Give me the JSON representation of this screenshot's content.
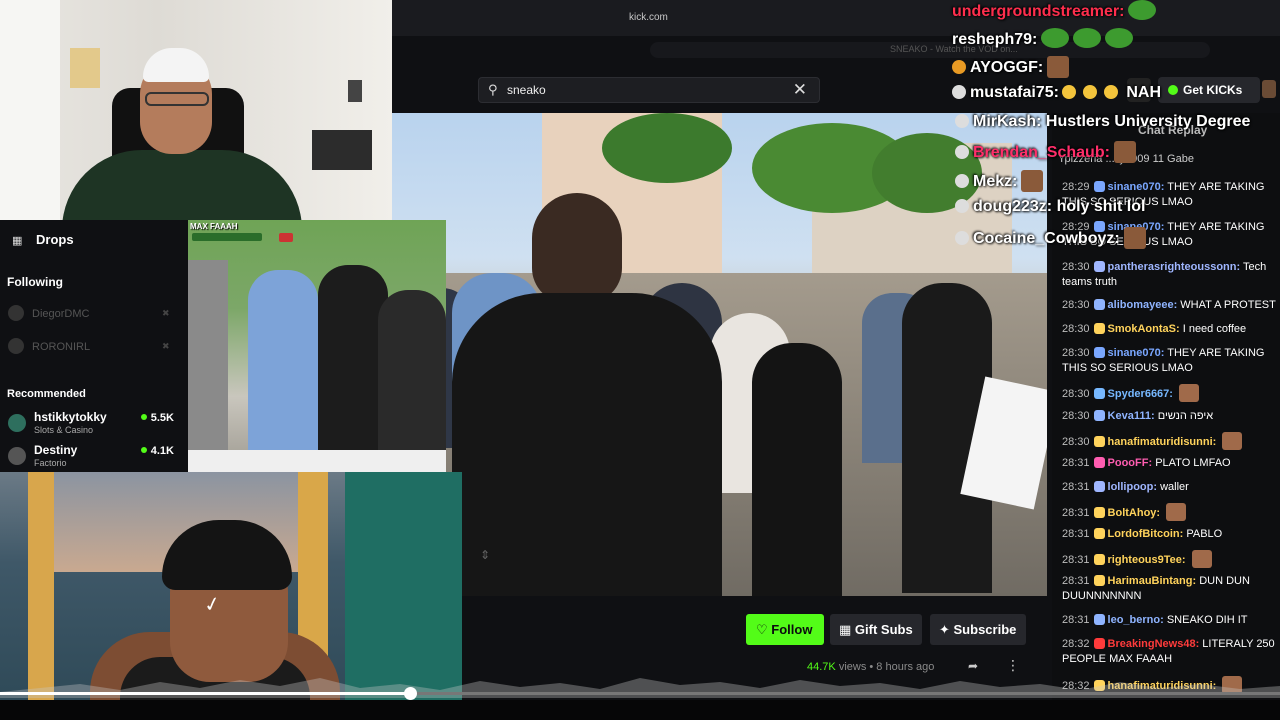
{
  "browser": {
    "url": "kick.com",
    "tab_title": "SNEAKO - Watch the VOD on...",
    "search": {
      "value": "sneako",
      "icon": "search-icon",
      "clear_icon": "close-icon"
    },
    "get_kicks_label": "Get KICKs"
  },
  "stream": {
    "follow_label": "♡ Follow",
    "gift_subs_label": "Gift Subs",
    "subscribe_label": "Subscribe",
    "views": "44.7K",
    "views_suffix": "views",
    "time_ago": "8 hours ago"
  },
  "sidebar": {
    "drops_label": "Drops",
    "following_label": "Following",
    "following": [
      {
        "name": "DiegorDMC"
      },
      {
        "name": "RORONIRL"
      }
    ],
    "recommended_label": "Recommended",
    "recommended": [
      {
        "name": "hstikkytokky",
        "category": "Slots & Casino",
        "viewers": "5.5K"
      },
      {
        "name": "Destiny",
        "category": "Factorio",
        "viewers": "4.1K"
      }
    ]
  },
  "overlay_cam2": {
    "label": "MAX FAAAH"
  },
  "alerts": [
    {
      "user": "undergroundstreamer:",
      "color": "#ff2e4d",
      "text": ""
    },
    {
      "user": "resheph79:",
      "color": "#ffffff",
      "text": ""
    },
    {
      "user": "AYOGGF:",
      "color": "#ffffff",
      "text": ""
    },
    {
      "user": "mustafai75:",
      "color": "#ffffff",
      "text": "NAH"
    },
    {
      "user": "MirKash:",
      "color": "#ffffff",
      "text": "Hustlers University Degree"
    },
    {
      "user": "Brendan_Schaub:",
      "color": "#ff2e6a",
      "text": ""
    },
    {
      "user": "Mekz:",
      "color": "#ffffff",
      "text": ""
    },
    {
      "user": "doug223z:",
      "color": "#ffffff",
      "text": "holy shit lol"
    },
    {
      "user": "Cocaine_Cowboyz:",
      "color": "#ffffff",
      "text": ""
    }
  ],
  "chat": {
    "title": "Chat Replay",
    "header": "Ypizzeria  ...lly0909  11    Gabe",
    "messages": [
      {
        "time": "28:29",
        "user": "sinane070:",
        "color": "#7aa7ff",
        "text": "THEY ARE TAKING THIS SO SERIOUS LMAO"
      },
      {
        "time": "28:29",
        "user": "sinane070:",
        "color": "#7aa7ff",
        "text": "THEY ARE TAKING THIS SO SERIOUS LMAO"
      },
      {
        "time": "28:30",
        "user": "pantherasrighteoussonn:",
        "color": "#9fb6ff",
        "text": "Tech teams truth"
      },
      {
        "time": "28:30",
        "user": "alibomayeee:",
        "color": "#8fb4ff",
        "text": "WHAT A PROTEST"
      },
      {
        "time": "28:30",
        "user": "SmokAontaS:",
        "color": "#ffd35c",
        "text": "I need coffee"
      },
      {
        "time": "28:30",
        "user": "sinane070:",
        "color": "#7aa7ff",
        "text": "THEY ARE TAKING THIS SO SERIOUS LMAO"
      },
      {
        "time": "28:30",
        "user": "Spyder6667:",
        "color": "#77b8ff",
        "text": ""
      },
      {
        "time": "28:30",
        "user": "Keva111:",
        "color": "#8fb4ff",
        "text": "איפה הנשים"
      },
      {
        "time": "28:30",
        "user": "hanafimaturidisunni:",
        "color": "#ffd35c",
        "text": ""
      },
      {
        "time": "28:31",
        "user": "PoooFF:",
        "color": "#ff5db1",
        "text": "PLATO LMFAO"
      },
      {
        "time": "28:31",
        "user": "lollipoop:",
        "color": "#9fb6ff",
        "text": "waller"
      },
      {
        "time": "28:31",
        "user": "BoltAhoy:",
        "color": "#ffd35c",
        "text": ""
      },
      {
        "time": "28:31",
        "user": "LordofBitcoin:",
        "color": "#ffd35c",
        "text": "PABLO"
      },
      {
        "time": "28:31",
        "user": "righteous9Tee:",
        "color": "#ffd35c",
        "text": ""
      },
      {
        "time": "28:31",
        "user": "HarimauBintang:",
        "color": "#ffd35c",
        "text": "DUN DUN DUUNNNNNNN"
      },
      {
        "time": "28:31",
        "user": "leo_berno:",
        "color": "#8fb4ff",
        "text": "SNEAKO DIH IT"
      },
      {
        "time": "28:32",
        "user": "BreakingNews48:",
        "color": "#ff3b3b",
        "text": "LITERALY 250 PEOPLE MAX FAAAH"
      },
      {
        "time": "28:32",
        "user": "hanafimaturidisunni:",
        "color": "#ffd35c",
        "text": ""
      }
    ]
  },
  "player": {
    "progress": 0.32
  },
  "colors": {
    "kick_green": "#53fc18",
    "panel": "#0f1013",
    "button": "#26272c"
  }
}
